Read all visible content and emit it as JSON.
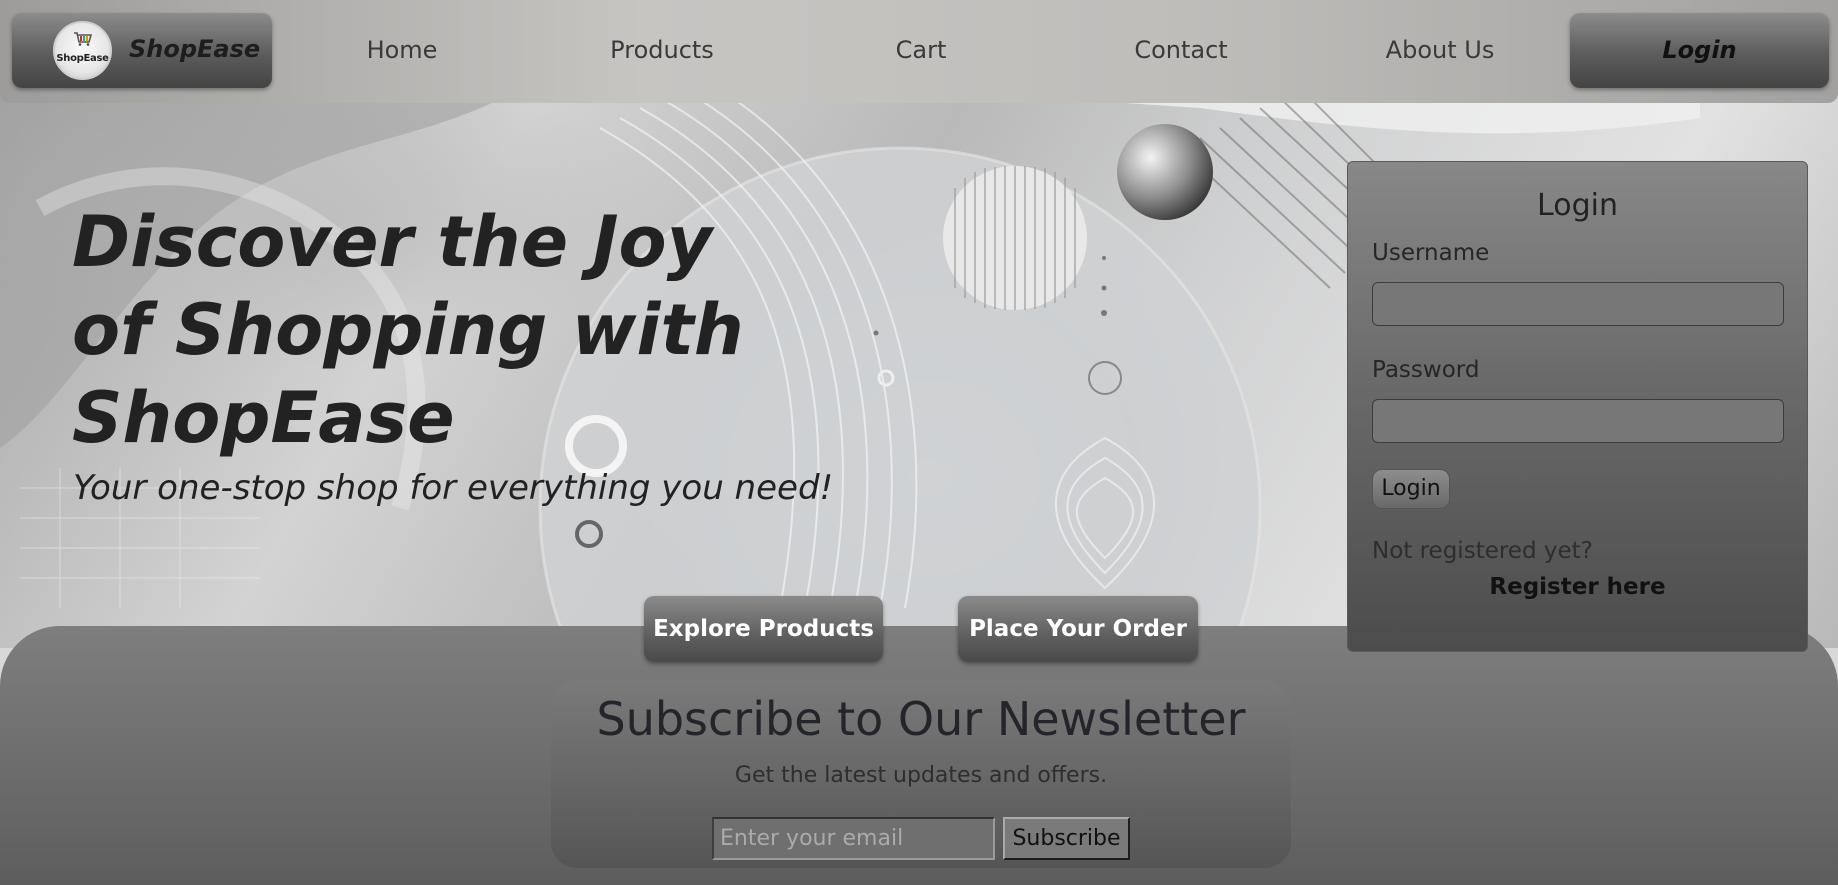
{
  "navbar": {
    "brand_name": "ShopEase",
    "logo_text": "ShopEase",
    "links": [
      "Home",
      "Products",
      "Cart",
      "Contact",
      "About Us"
    ],
    "login_label": "Login"
  },
  "hero": {
    "title": "Discover the Joy of Shopping with ShopEase",
    "subtitle": "Your one-stop shop for everything you need!",
    "explore_label": "Explore Products",
    "order_label": "Place Your Order"
  },
  "login_panel": {
    "title": "Login",
    "username_label": "Username",
    "username_value": "",
    "password_label": "Password",
    "password_value": "",
    "button_label": "Login",
    "not_registered": "Not registered yet?",
    "register_link": "Register here"
  },
  "newsletter": {
    "title": "Subscribe to Our Newsletter",
    "description": "Get the latest updates and offers.",
    "email_placeholder": "Enter your email",
    "subscribe_label": "Subscribe"
  }
}
